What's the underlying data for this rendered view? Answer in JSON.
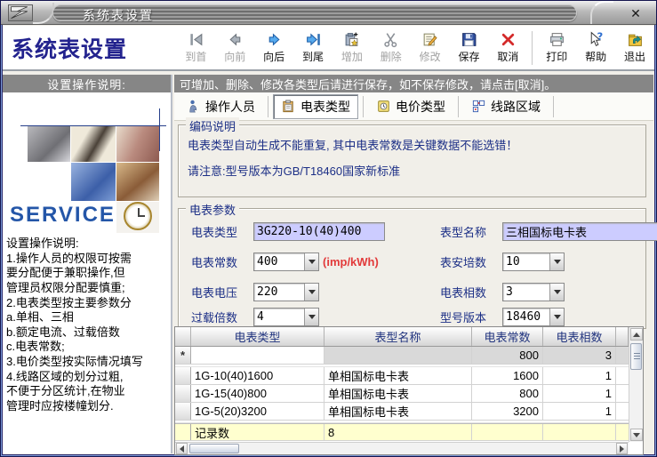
{
  "window": {
    "title": "系统表设置",
    "close_icon": "✕"
  },
  "header": {
    "app_title": "系统表设置"
  },
  "toolbar": {
    "buttons": [
      {
        "label": "到首",
        "enabled": false
      },
      {
        "label": "向前",
        "enabled": false
      },
      {
        "label": "向后",
        "enabled": true
      },
      {
        "label": "到尾",
        "enabled": true
      },
      {
        "label": "增加",
        "enabled": false
      },
      {
        "label": "删除",
        "enabled": false
      },
      {
        "label": "修改",
        "enabled": false
      },
      {
        "label": "保存",
        "enabled": true
      },
      {
        "label": "取消",
        "enabled": true
      },
      {
        "label": "打印",
        "enabled": true
      },
      {
        "label": "帮助",
        "enabled": true
      },
      {
        "label": "退出",
        "enabled": true
      }
    ]
  },
  "sidebar": {
    "header": "设置操作说明:",
    "service_text": "SERVICE",
    "instructions": "设置操作说明:\n1.操作人员的权限可按需\n要分配便于兼职操作,但\n管理员权限分配要慎重;\n2.电表类型按主要参数分\n a.单相、三相\n b.额定电流、过载倍数\n c.电表常数;\n3.电价类型按实际情况填写\n4.线路区域的划分过粗,\n不便于分区统计,在物业\n管理时应按楼幢划分."
  },
  "main": {
    "notice": "可增加、删除、修改各类型后请进行保存，如不保存修改，请点击[取消]。",
    "tabs": [
      {
        "label": "操作人员",
        "selected": false
      },
      {
        "label": "电表类型",
        "selected": true
      },
      {
        "label": "电价类型",
        "selected": false
      },
      {
        "label": "线路区域",
        "selected": false
      }
    ],
    "encoding_box": {
      "title": "编码说明",
      "line1": "电表类型自动生成不能重复, 其中电表常数是关键数据不能选错！",
      "line2": "请注意:型号版本为GB/T18460国家新标准"
    },
    "params_box": {
      "title": "电表参数",
      "meter_type": {
        "label": "电表类型",
        "value": "3G220-10(40)400"
      },
      "model_name": {
        "label": "表型名称",
        "value": "三相国标电卡表"
      },
      "meter_constant": {
        "label": "电表常数",
        "value": "400",
        "unit": "(imp/kWh)"
      },
      "ampere": {
        "label": "表安培数",
        "value": "10"
      },
      "voltage": {
        "label": "电表电压",
        "value": "220"
      },
      "phase": {
        "label": "电表相数",
        "value": "3"
      },
      "overload": {
        "label": "过载倍数",
        "value": "4"
      },
      "version": {
        "label": "型号版本",
        "value": "18460"
      }
    },
    "grid": {
      "columns": [
        "电表类型",
        "表型名称",
        "电表常数",
        "电表相数"
      ],
      "new_row": {
        "selector": "*",
        "meter_type": "",
        "model_name": "",
        "constant": "800",
        "phase": "3"
      },
      "rows": [
        {
          "meter_type": "1G-10(40)1600",
          "model_name": "单相国标电卡表",
          "constant": "1600",
          "phase": "1"
        },
        {
          "meter_type": "1G-15(40)800",
          "model_name": "单相国标电卡表",
          "constant": "800",
          "phase": "1"
        },
        {
          "meter_type": "1G-5(20)3200",
          "model_name": "单相国标电卡表",
          "constant": "3200",
          "phase": "1"
        }
      ],
      "footer": {
        "label": "记录数",
        "value": "8"
      }
    }
  },
  "colors": {
    "accent_navy": "#1c2f86",
    "notice_gray": "#868686",
    "input_bg": "#ccccff",
    "footer_yellow": "#ffffcf",
    "unit_red": "#e23a3a"
  }
}
